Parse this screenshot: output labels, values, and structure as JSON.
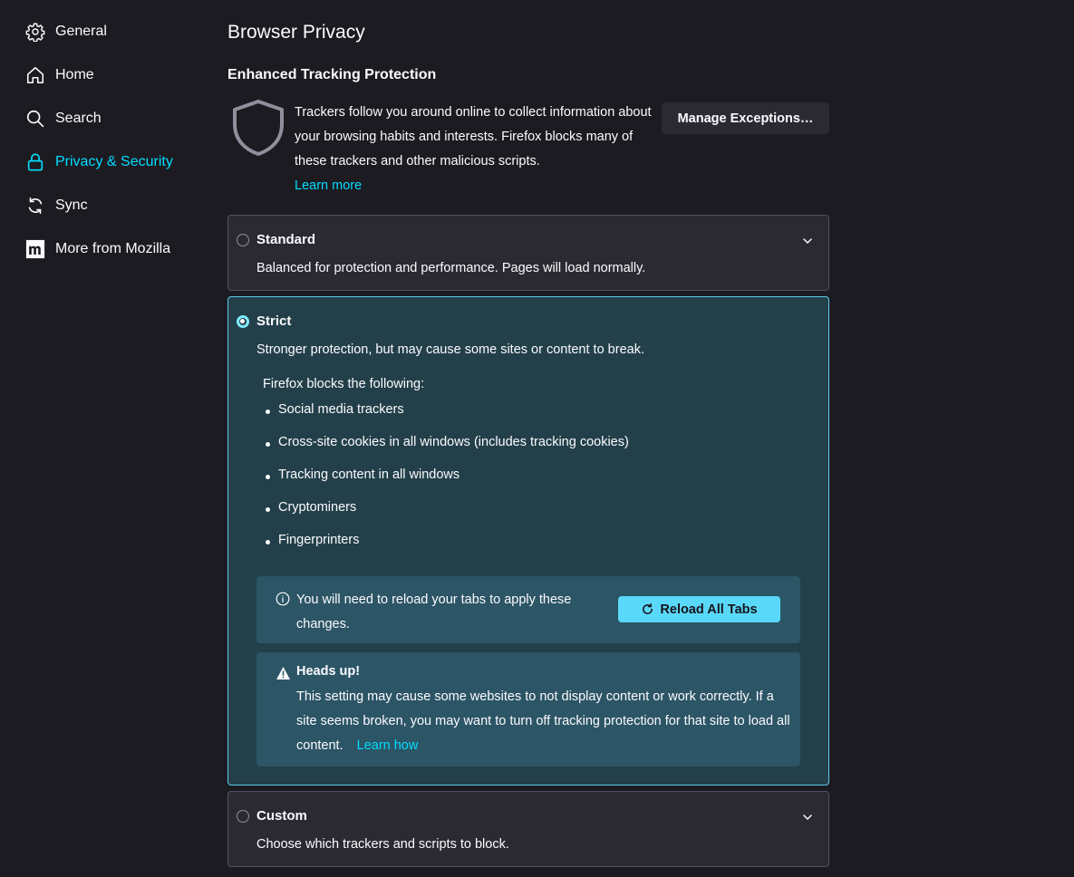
{
  "sidebar": {
    "items": [
      {
        "label": "General",
        "icon": "gear-icon",
        "selected": false
      },
      {
        "label": "Home",
        "icon": "home-icon",
        "selected": false
      },
      {
        "label": "Search",
        "icon": "search-icon",
        "selected": false
      },
      {
        "label": "Privacy & Security",
        "icon": "lock-icon",
        "selected": true
      },
      {
        "label": "Sync",
        "icon": "sync-icon",
        "selected": false
      },
      {
        "label": "More from Mozilla",
        "icon": "mozilla-m-icon",
        "selected": false
      }
    ]
  },
  "main": {
    "title": "Browser Privacy",
    "etp": {
      "heading": "Enhanced Tracking Protection",
      "description": "Trackers follow you around online to collect information about your browsing habits and interests. Firefox blocks many of these trackers and other malicious scripts.",
      "learn_more": "Learn more",
      "manage_button": "Manage Exceptions…"
    },
    "options": {
      "standard": {
        "title": "Standard",
        "description": "Balanced for protection and performance. Pages will load normally.",
        "checked": false
      },
      "strict": {
        "title": "Strict",
        "description": "Stronger protection, but may cause some sites or content to break.",
        "checked": true,
        "blocks_heading": "Firefox blocks the following:",
        "blocks": [
          "Social media trackers",
          "Cross-site cookies in all windows (includes tracking cookies)",
          "Tracking content in all windows",
          "Cryptominers",
          "Fingerprinters"
        ],
        "reload_notice": {
          "text": "You will need to reload your tabs to apply these changes.",
          "button": "Reload All Tabs"
        },
        "heads_up": {
          "title": "Heads up!",
          "text": "This setting may cause some websites to not display content or work correctly. If a site seems broken, you may want to turn off tracking protection for that site to load all content.",
          "link": "Learn how"
        }
      },
      "custom": {
        "title": "Custom",
        "description": "Choose which trackers and scripts to block.",
        "checked": false
      }
    }
  },
  "colors": {
    "background": "#1c1b22",
    "accent": "#00ddff",
    "selected_card_bg": "#23404a",
    "notice_bg": "#2c5566",
    "reload_button": "#5ad8f9"
  }
}
